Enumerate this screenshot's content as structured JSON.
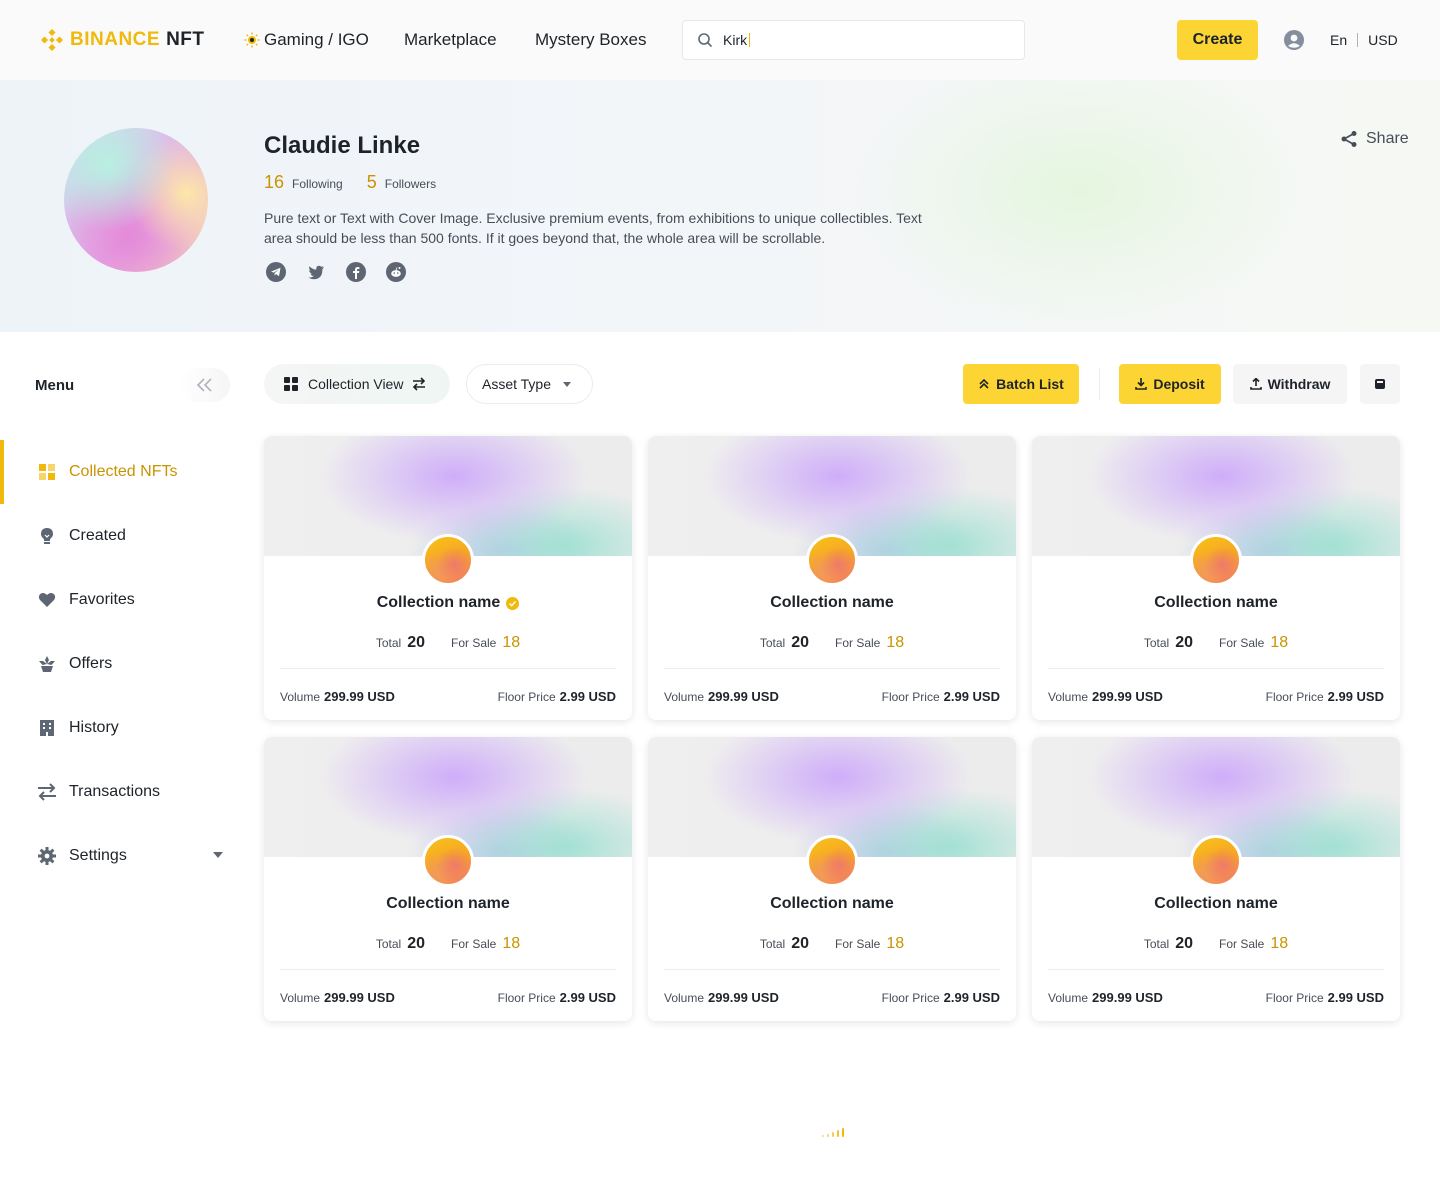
{
  "header": {
    "logo_text": "BINANCE",
    "logo_suffix": "NFT",
    "nav": [
      "Gaming / IGO",
      "Marketplace",
      "Mystery Boxes"
    ],
    "search_value": "Kirk",
    "user_center": "User Center",
    "create_label": "Create",
    "lang": "En",
    "currency": "USD",
    "accent_color": "#FCD535",
    "brand_color": "#F0B90B"
  },
  "profile": {
    "name": "Claudie Linke",
    "following_count": "16",
    "following_label": "Following",
    "followers_count": "5",
    "followers_label": "Followers",
    "bio": "Pure text or Text with Cover Image. Exclusive premium events, from exhibitions to unique collectibles. Text area should be less than 500 fonts. If it goes beyond that, the whole area will be scrollable.",
    "socials": [
      "telegram-icon",
      "twitter-icon",
      "facebook-icon",
      "reddit-icon"
    ],
    "share_label": "Share"
  },
  "sidebar": {
    "title": "Menu",
    "items": [
      {
        "label": "Collected NFTs",
        "icon": "grid-icon",
        "active": true
      },
      {
        "label": "Created",
        "icon": "bulb-icon"
      },
      {
        "label": "Favorites",
        "icon": "heart-icon"
      },
      {
        "label": "Offers",
        "icon": "offer-icon"
      },
      {
        "label": "History",
        "icon": "building-icon"
      },
      {
        "label": "Transactions",
        "icon": "transfer-icon"
      },
      {
        "label": "Settings",
        "icon": "gear-icon"
      }
    ]
  },
  "toolbar": {
    "view_label": "Collection View",
    "asset_type_label": "Asset Type",
    "batch_list_label": "Batch List",
    "deposit_label": "Deposit",
    "withdraw_label": "Withdraw"
  },
  "cards": [
    {
      "name": "Collection name",
      "verified": true,
      "total_label": "Total",
      "total": "20",
      "sale_label": "For Sale",
      "for_sale": "18",
      "volume_label": "Volume",
      "volume": "299.99 USD",
      "floor_label": "Floor Price",
      "floor": "2.99 USD"
    },
    {
      "name": "Collection name",
      "total_label": "Total",
      "total": "20",
      "sale_label": "For Sale",
      "for_sale": "18",
      "volume_label": "Volume",
      "volume": "299.99 USD",
      "floor_label": "Floor Price",
      "floor": "2.99 USD"
    },
    {
      "name": "Collection name",
      "total_label": "Total",
      "total": "20",
      "sale_label": "For Sale",
      "for_sale": "18",
      "volume_label": "Volume",
      "volume": "299.99 USD",
      "floor_label": "Floor Price",
      "floor": "2.99 USD"
    },
    {
      "name": "Collection name",
      "total_label": "Total",
      "total": "20",
      "sale_label": "For Sale",
      "for_sale": "18",
      "volume_label": "Volume",
      "volume": "299.99 USD",
      "floor_label": "Floor Price",
      "floor": "2.99 USD"
    },
    {
      "name": "Collection name",
      "total_label": "Total",
      "total": "20",
      "sale_label": "For Sale",
      "for_sale": "18",
      "volume_label": "Volume",
      "volume": "299.99 USD",
      "floor_label": "Floor Price",
      "floor": "2.99 USD"
    },
    {
      "name": "Collection name",
      "total_label": "Total",
      "total": "20",
      "sale_label": "For Sale",
      "for_sale": "18",
      "volume_label": "Volume",
      "volume": "299.99 USD",
      "floor_label": "Floor Price",
      "floor": "2.99 USD"
    }
  ]
}
